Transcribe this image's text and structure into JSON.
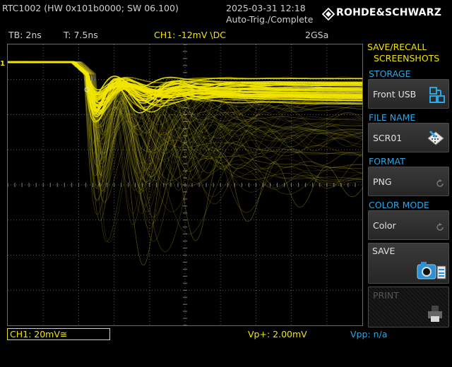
{
  "header": {
    "device_info": "RTC1002 (HW 0x101b0000; SW 06.100)",
    "datetime": "2025-03-31 12:18",
    "trigger_status": "Auto-Trig./Complete",
    "brand": "ROHDE&SCHWARZ"
  },
  "status": {
    "timebase": "TB: 2ns",
    "trigger_time": "T: 7.5ns",
    "channel_trigger": "CH1: -12mV \\DC",
    "sample_rate": "2GSa"
  },
  "markers": {
    "ch1_ground": "1"
  },
  "menu": {
    "title_line1": "SAVE/RECALL",
    "title_line2": "SCREENSHOTS",
    "storage_label": "STORAGE",
    "storage_value": "Front USB",
    "file_name_label": "FILE NAME",
    "file_name_value": "SCR01",
    "format_label": "FORMAT",
    "format_value": "PNG",
    "color_mode_label": "COLOR MODE",
    "color_mode_value": "Color",
    "save_label": "SAVE",
    "print_label": "PRINT"
  },
  "footer": {
    "ch1_scale": "CH1: 20mV≅",
    "vp_plus": "Vp+: 2.00mV",
    "vpp": "Vpp: n/a"
  },
  "icons": {
    "storage": "usb-storage-icon",
    "file_name": "keyboard-pen-icon",
    "save": "camera-save-icon",
    "print": "printer-icon",
    "brand": "rs-diamond-logo-icon"
  },
  "colors": {
    "trace": "#f2e600",
    "accent": "#29a8e8",
    "grid": "#5a5a5a"
  }
}
